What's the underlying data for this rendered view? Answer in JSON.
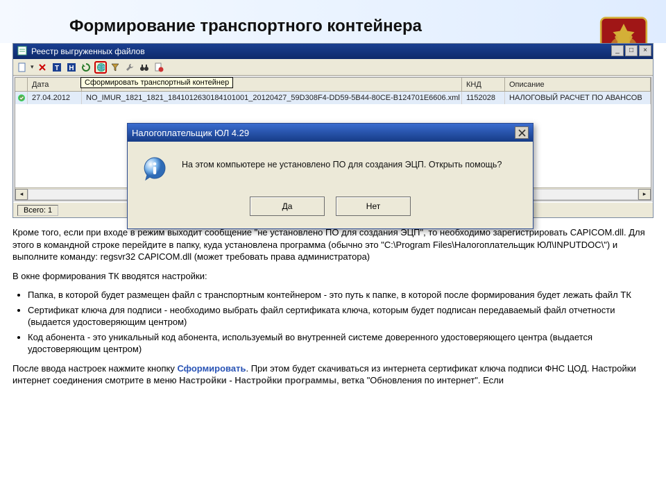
{
  "heading": "Формирование транспортного контейнера",
  "app": {
    "title": "Реестр выгруженных файлов",
    "toolbar": {
      "tooltip": "Сформировать транспортный контейнер",
      "icons": [
        "new-doc",
        "delete",
        "t-icon",
        "h-icon",
        "refresh-icon",
        "globe-icon",
        "filter-icon",
        "wrench-icon",
        "binoculars-icon",
        "doc-icon"
      ]
    },
    "columns": {
      "date": "Дата",
      "file": "",
      "knd": "КНД",
      "desc": "Описание"
    },
    "row": {
      "date": "27.04.2012",
      "file": "NO_IMUR_1821_1821_1841012630184101001_20120427_59D308F4-DD59-5B44-80CE-B124701E6606.xml",
      "knd": "1152028",
      "desc": "НАЛОГОВЫЙ РАСЧЕТ ПО АВАНСОВ"
    },
    "status": {
      "label": "Всего:",
      "count": "1"
    },
    "winbtns": {
      "min": "_",
      "max": "□",
      "close": "×"
    }
  },
  "dialog": {
    "title": "Налогоплательщик ЮЛ 4.29",
    "message": "На этом компьютере не установлено ПО для создания ЭЦП. Открыть помощь?",
    "yes": "Да",
    "no": "Нет"
  },
  "article": {
    "p1": "Кроме того, если при входе в режим выходит сообщение \"не установлено ПО для создания ЭЦП\", то необходимо зарегистрировать CAPICOM.dll. Для этого в командной строке перейдите в папку, куда установлена программа (обычно это \"C:\\Program Files\\Налогоплательщик ЮЛ\\INPUTDOC\\\") и выполните команду: regsvr32 CAPICOM.dll (может требовать права администратора)",
    "p2": "В окне формирования ТК вводятся настройки:",
    "li1": "Папка, в которой будет размещен файл с транспортным контейнером - это путь к папке, в которой после формирования будет лежать файл ТК",
    "li2": "Сертификат ключа для подписи - необходимо выбрать файл сертификата ключа, которым будет подписан передаваемый файл отчетности (выдается удостоверяющим центром)",
    "li3": "Код абонента - это уникальный код абонента, используемый во внутренней системе доверенного удостоверяющего центра (выдается удостоверяющим центром)",
    "p3a": "После ввода настроек нажмите кнопку ",
    "p3b": "Сформировать",
    "p3c": ". При этом будет скачиваться из интернета сертификат ключа подписи ФНС ЦОД. Настройки интернет соединения смотрите в меню ",
    "p3d": "Настройки - Настройки программы",
    "p3e": ", ветка \"Обновления по интернет\". Если"
  }
}
